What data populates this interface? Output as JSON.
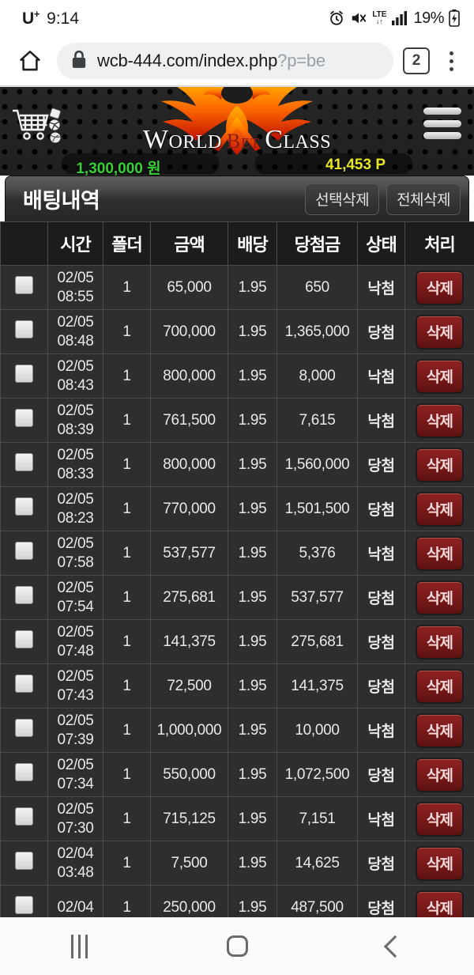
{
  "status_bar": {
    "carrier": "U",
    "carrier_sup": "+",
    "time": "9:14",
    "battery": "19%",
    "network_label": "LTE",
    "icons": [
      "alarm-icon",
      "mute-icon",
      "lte-icon",
      "signal-icon",
      "battery-charging-icon"
    ]
  },
  "browser": {
    "home_icon": "home-icon",
    "lock_icon": "lock-icon",
    "url_visible": "wcb-444.com/index.php",
    "url_dim": "?p=be",
    "tab_count": "2",
    "menu_icon": "kebab-menu-icon"
  },
  "site_header": {
    "cart_icon": "shopping-cart-icon",
    "menu_icon": "hamburger-menu-icon",
    "logo_word1": "World",
    "logo_word_mid": "Bet",
    "logo_word2": "Class",
    "balance_money": "1,300,000 원",
    "balance_points": "41,453 P",
    "money_color": "#35d135",
    "points_color": "#e8e81e"
  },
  "page": {
    "title": "배팅내역",
    "buttons": [
      {
        "label": "선택삭제",
        "name": "delete-selected-button"
      },
      {
        "label": "전체삭제",
        "name": "delete-all-button"
      }
    ]
  },
  "table": {
    "columns": [
      "",
      "시간",
      "폴더",
      "금액",
      "배당",
      "당첨금",
      "상태",
      "처리"
    ],
    "action_label": "삭제",
    "status_win": "당첨",
    "status_lose": "낙첨",
    "status_colors": {
      "win": "#33a8ff",
      "lose": "#ff2b2b"
    },
    "rows": [
      {
        "date": "02/05",
        "time": "08:55",
        "folder": "1",
        "amount": "65,000",
        "odds": "1.95",
        "payout": "650",
        "status": "낙첨",
        "status_type": "lose",
        "action": "삭제"
      },
      {
        "date": "02/05",
        "time": "08:48",
        "folder": "1",
        "amount": "700,000",
        "odds": "1.95",
        "payout": "1,365,000",
        "status": "당첨",
        "status_type": "win",
        "action": "삭제"
      },
      {
        "date": "02/05",
        "time": "08:43",
        "folder": "1",
        "amount": "800,000",
        "odds": "1.95",
        "payout": "8,000",
        "status": "낙첨",
        "status_type": "lose",
        "action": "삭제"
      },
      {
        "date": "02/05",
        "time": "08:39",
        "folder": "1",
        "amount": "761,500",
        "odds": "1.95",
        "payout": "7,615",
        "status": "낙첨",
        "status_type": "lose",
        "action": "삭제"
      },
      {
        "date": "02/05",
        "time": "08:33",
        "folder": "1",
        "amount": "800,000",
        "odds": "1.95",
        "payout": "1,560,000",
        "status": "당첨",
        "status_type": "win",
        "action": "삭제"
      },
      {
        "date": "02/05",
        "time": "08:23",
        "folder": "1",
        "amount": "770,000",
        "odds": "1.95",
        "payout": "1,501,500",
        "status": "당첨",
        "status_type": "win",
        "action": "삭제"
      },
      {
        "date": "02/05",
        "time": "07:58",
        "folder": "1",
        "amount": "537,577",
        "odds": "1.95",
        "payout": "5,376",
        "status": "낙첨",
        "status_type": "lose",
        "action": "삭제"
      },
      {
        "date": "02/05",
        "time": "07:54",
        "folder": "1",
        "amount": "275,681",
        "odds": "1.95",
        "payout": "537,577",
        "status": "당첨",
        "status_type": "win",
        "action": "삭제"
      },
      {
        "date": "02/05",
        "time": "07:48",
        "folder": "1",
        "amount": "141,375",
        "odds": "1.95",
        "payout": "275,681",
        "status": "당첨",
        "status_type": "win",
        "action": "삭제"
      },
      {
        "date": "02/05",
        "time": "07:43",
        "folder": "1",
        "amount": "72,500",
        "odds": "1.95",
        "payout": "141,375",
        "status": "당첨",
        "status_type": "win",
        "action": "삭제"
      },
      {
        "date": "02/05",
        "time": "07:39",
        "folder": "1",
        "amount": "1,000,000",
        "odds": "1.95",
        "payout": "10,000",
        "status": "낙첨",
        "status_type": "lose",
        "action": "삭제"
      },
      {
        "date": "02/05",
        "time": "07:34",
        "folder": "1",
        "amount": "550,000",
        "odds": "1.95",
        "payout": "1,072,500",
        "status": "당첨",
        "status_type": "win",
        "action": "삭제"
      },
      {
        "date": "02/05",
        "time": "07:30",
        "folder": "1",
        "amount": "715,125",
        "odds": "1.95",
        "payout": "7,151",
        "status": "낙첨",
        "status_type": "lose",
        "action": "삭제"
      },
      {
        "date": "02/04",
        "time": "03:48",
        "folder": "1",
        "amount": "7,500",
        "odds": "1.95",
        "payout": "14,625",
        "status": "당첨",
        "status_type": "win",
        "action": "삭제"
      },
      {
        "date": "02/04",
        "time": "",
        "folder": "1",
        "amount": "250,000",
        "odds": "1.95",
        "payout": "487,500",
        "status": "당첨",
        "status_type": "win",
        "action": "삭제"
      }
    ]
  },
  "nav_bar": {
    "recents_label": "recents-icon",
    "home_label": "home-icon",
    "back_label": "back-icon"
  }
}
